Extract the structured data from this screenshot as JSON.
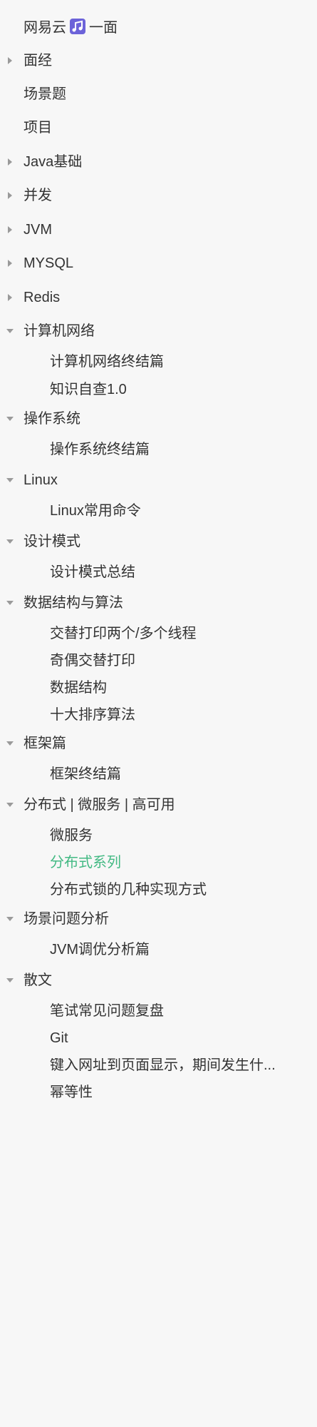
{
  "sidebar": {
    "accent_color": "#42b983",
    "items": [
      {
        "label": "网易云",
        "suffix": "一面",
        "icon": "music-icon"
      },
      {
        "label": "面经"
      },
      {
        "label": "场景题"
      },
      {
        "label": "项目"
      },
      {
        "label": "Java基础"
      },
      {
        "label": "并发"
      },
      {
        "label": "JVM"
      },
      {
        "label": "MYSQL"
      },
      {
        "label": "Redis"
      },
      {
        "label": "计算机网络"
      },
      {
        "label": "计算机网络终结篇"
      },
      {
        "label": "知识自查1.0"
      },
      {
        "label": "操作系统"
      },
      {
        "label": "操作系统终结篇"
      },
      {
        "label": "Linux"
      },
      {
        "label": "Linux常用命令"
      },
      {
        "label": "设计模式"
      },
      {
        "label": "设计模式总结"
      },
      {
        "label": "数据结构与算法"
      },
      {
        "label": "交替打印两个/多个线程"
      },
      {
        "label": "奇偶交替打印"
      },
      {
        "label": "数据结构"
      },
      {
        "label": "十大排序算法"
      },
      {
        "label": "框架篇"
      },
      {
        "label": "框架终结篇"
      },
      {
        "label": "分布式 | 微服务 | 高可用"
      },
      {
        "label": "微服务"
      },
      {
        "label": "分布式系列",
        "active": true
      },
      {
        "label": "分布式锁的几种实现方式"
      },
      {
        "label": "场景问题分析"
      },
      {
        "label": "JVM调优分析篇"
      },
      {
        "label": "散文"
      },
      {
        "label": "笔试常见问题复盘"
      },
      {
        "label": "Git"
      },
      {
        "label": "键入网址到页面显示，期间发生什..."
      },
      {
        "label": "幂等性"
      }
    ]
  }
}
